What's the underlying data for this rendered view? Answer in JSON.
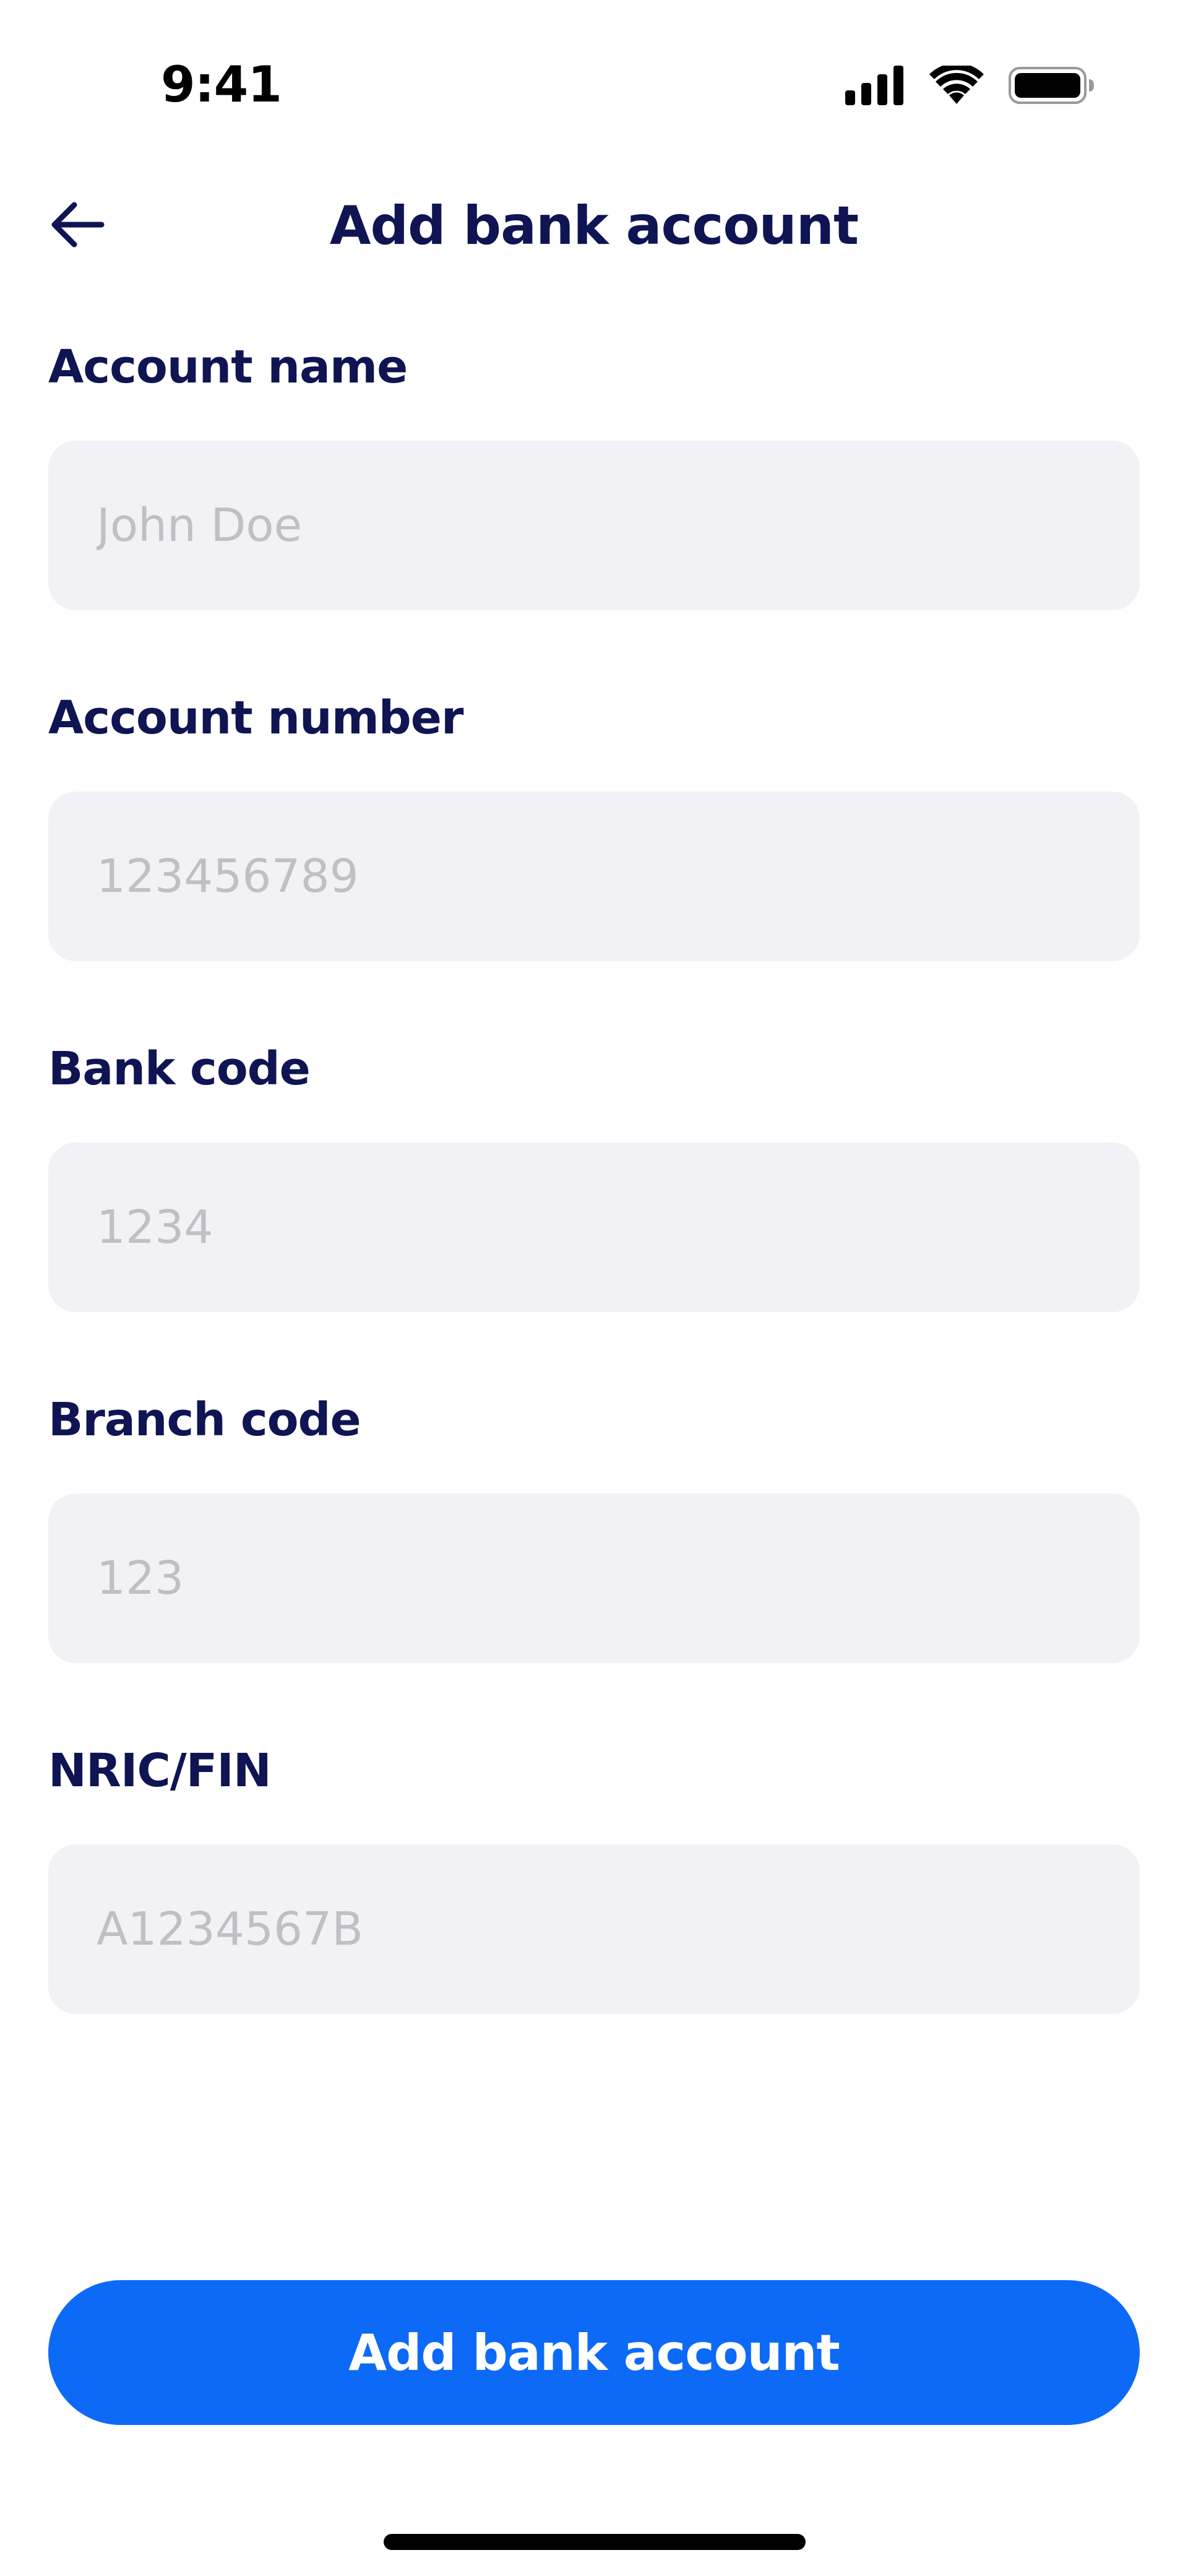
{
  "status_bar": {
    "time": "9:41",
    "icons": [
      "cellular-signal-icon",
      "wifi-icon",
      "battery-icon"
    ]
  },
  "header": {
    "title": "Add bank account",
    "back_icon": "arrow-left-icon"
  },
  "form": {
    "fields": [
      {
        "label": "Account name",
        "placeholder": "John Doe"
      },
      {
        "label": "Account number",
        "placeholder": "123456789"
      },
      {
        "label": "Bank code",
        "placeholder": "1234"
      },
      {
        "label": "Branch code",
        "placeholder": "123"
      },
      {
        "label": "NRIC/FIN",
        "placeholder": "A1234567B"
      }
    ]
  },
  "submit": {
    "label": "Add bank account"
  },
  "colors": {
    "primary": "#0D6AF7",
    "text_dark": "#0F1453",
    "input_bg": "#F2F2F6",
    "placeholder": "#BFBFC6"
  }
}
